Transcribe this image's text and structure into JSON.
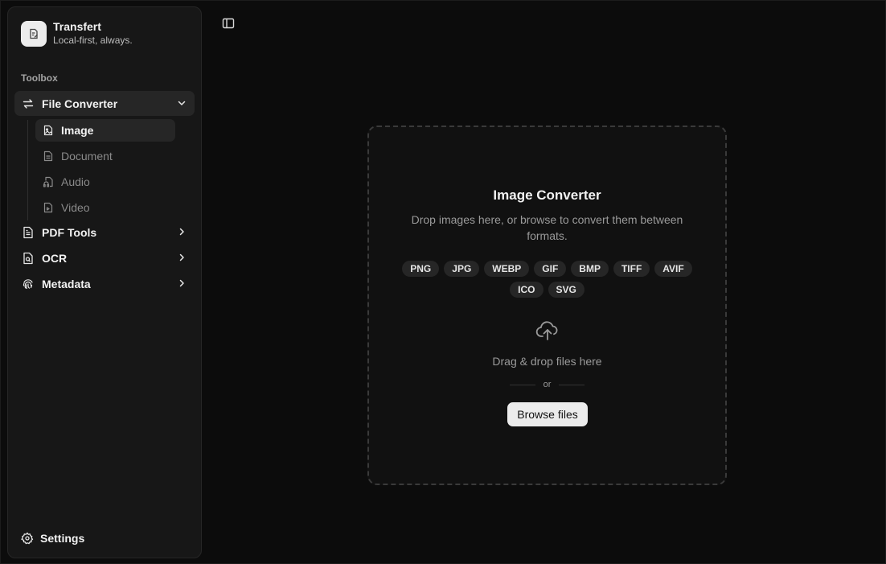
{
  "brand": {
    "name": "Transfert",
    "tagline": "Local-first, always."
  },
  "sidebar": {
    "section_label": "Toolbox",
    "items": [
      {
        "label": "File Converter",
        "icon": "arrows-swap-icon",
        "expanded": true
      },
      {
        "label": "PDF Tools",
        "icon": "file-text-icon"
      },
      {
        "label": "OCR",
        "icon": "file-scan-icon"
      },
      {
        "label": "Metadata",
        "icon": "fingerprint-icon"
      }
    ],
    "sub_items": [
      {
        "label": "Image",
        "icon": "file-image-icon",
        "active": true
      },
      {
        "label": "Document",
        "icon": "file-doc-icon"
      },
      {
        "label": "Audio",
        "icon": "file-audio-icon"
      },
      {
        "label": "Video",
        "icon": "file-video-icon"
      }
    ],
    "settings_label": "Settings"
  },
  "main": {
    "title": "Image Converter",
    "description": "Drop images here, or browse to convert them between formats.",
    "formats": [
      "PNG",
      "JPG",
      "WEBP",
      "GIF",
      "BMP",
      "TIFF",
      "AVIF",
      "ICO",
      "SVG"
    ],
    "drag_text": "Drag & drop files here",
    "or_text": "or",
    "browse_label": "Browse files"
  }
}
